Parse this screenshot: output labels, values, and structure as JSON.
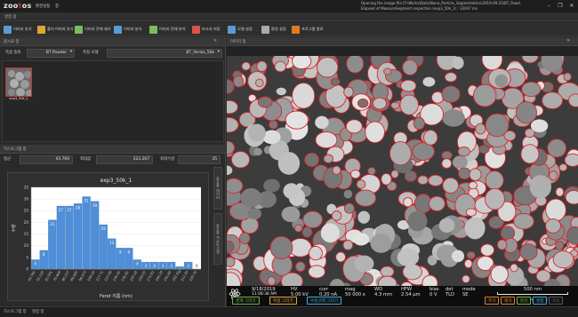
{
  "app": {
    "logo": "zootos",
    "menu": [
      "환경설정",
      "창"
    ],
    "notice_lines": [
      "Opening the image file [F:\\Works\\Data\\Nano_Particle_Segmentation\\2019-09-23\\BT_Powd...",
      "Elapsed of MeasureSegment inspection (exp3_50k_1) : 33047 ms"
    ],
    "window_controls": [
      "–",
      "❐",
      "✕"
    ]
  },
  "command_panel_title": "명령 창",
  "toolbar": [
    {
      "label": "이미지 추가",
      "icon": "image-add-icon",
      "color": "#5a9bd5"
    },
    {
      "label": "폴더 이미지 추가",
      "icon": "folder-add-icon",
      "color": "#e0a63a"
    },
    {
      "label": "이미지 전체 제거",
      "icon": "image-clear-icon",
      "color": "#7dbb5f"
    },
    {
      "label": "이미지 분석",
      "icon": "analyze-icon",
      "color": "#5a9bd5"
    },
    {
      "label": "이미지 전체 분석",
      "icon": "analyze-all-icon",
      "color": "#7dbb5f"
    },
    {
      "label": "보고서 저장",
      "icon": "report-icon",
      "color": "#d9534f"
    },
    {
      "label": "모델 설정",
      "icon": "model-settings-icon",
      "color": "#5a9bd5"
    },
    {
      "label": "환경 설정",
      "icon": "wrench-icon",
      "color": "#aaaaaa"
    },
    {
      "label": "프로그램 종료",
      "icon": "exit-icon",
      "color": "#e07b22"
    }
  ],
  "image_panel": {
    "title": "이미지 창"
  },
  "measure_panel": {
    "title": "원시료 창",
    "item_label": "측정 종류",
    "item_value": "BT Powder",
    "model_label": "측정 모델",
    "model_value": "BT_Verios_50k",
    "thumbnail_label": "exp3_50k_1"
  },
  "histogram_panel": {
    "title": "히스토그램 창",
    "stats": [
      {
        "label": "평균",
        "value": "43.760"
      },
      {
        "label": "최대값",
        "value": "223.267"
      },
      {
        "label": "최대수량",
        "value": "35"
      }
    ],
    "side_tabs": [
      "분포창 데이터",
      "분포창 히스토그램"
    ]
  },
  "chart_data": {
    "type": "bar",
    "title": "exp3_50k_1",
    "xlabel": "Feret 지름 (nm)",
    "ylabel": "수량",
    "ylim": [
      0,
      35
    ],
    "y_ticks": [
      0,
      5,
      10,
      15,
      20,
      25,
      30,
      35
    ],
    "categories": [
      "42.765",
      "52.133",
      "61.501",
      "70.869",
      "80.237",
      "89.605",
      "98.973",
      "108.34",
      "117.71",
      "127.08",
      "136.45",
      "145.81",
      "155.18",
      "164.55",
      "173.92",
      "183.29",
      "192.66",
      "202.02",
      "211.39",
      "220.76"
    ],
    "values": [
      4,
      8,
      21,
      27,
      27,
      28,
      31,
      29,
      19,
      13,
      9,
      9,
      4,
      3,
      3,
      3,
      3,
      1,
      3,
      0
    ],
    "color": "#4f8ed8"
  },
  "sem": {
    "date": "9/18/2019",
    "time": "11:08:38 AM",
    "hv_label": "HV",
    "hv": "5.00 kV",
    "curr_label": "curr",
    "curr": "0.20 nA",
    "mag_label": "mag",
    "mag": "50 000 x",
    "wd_label": "WD",
    "wd": "4.3 mm",
    "hfw_label": "HFW",
    "hfw": "2.54 µm",
    "bias_label": "bias",
    "bias": "0 V",
    "det_label": "det",
    "det": "TLD",
    "mode_label": "mode",
    "mode": "SE",
    "scale": "500 nm",
    "instrument": "Verios G4",
    "tools": [
      {
        "label": "경계 그리기",
        "color": "#6db33f"
      },
      {
        "label": "측정 그리기",
        "color": "#e0a63a"
      },
      {
        "label": "수동선택 그리기",
        "color": "#3fa9d9"
      },
      {
        "label": "추가",
        "color": "#e07b22"
      },
      {
        "label": "제거",
        "color": "#e07b22"
      },
      {
        "label": "분리",
        "color": "#6db33f"
      },
      {
        "label": "병합",
        "color": "#3fa9d9"
      },
      {
        "label": "적용",
        "color": "#5a5a5a"
      }
    ]
  },
  "status": {
    "left": "히스토그램 창",
    "right": "명령 창"
  }
}
